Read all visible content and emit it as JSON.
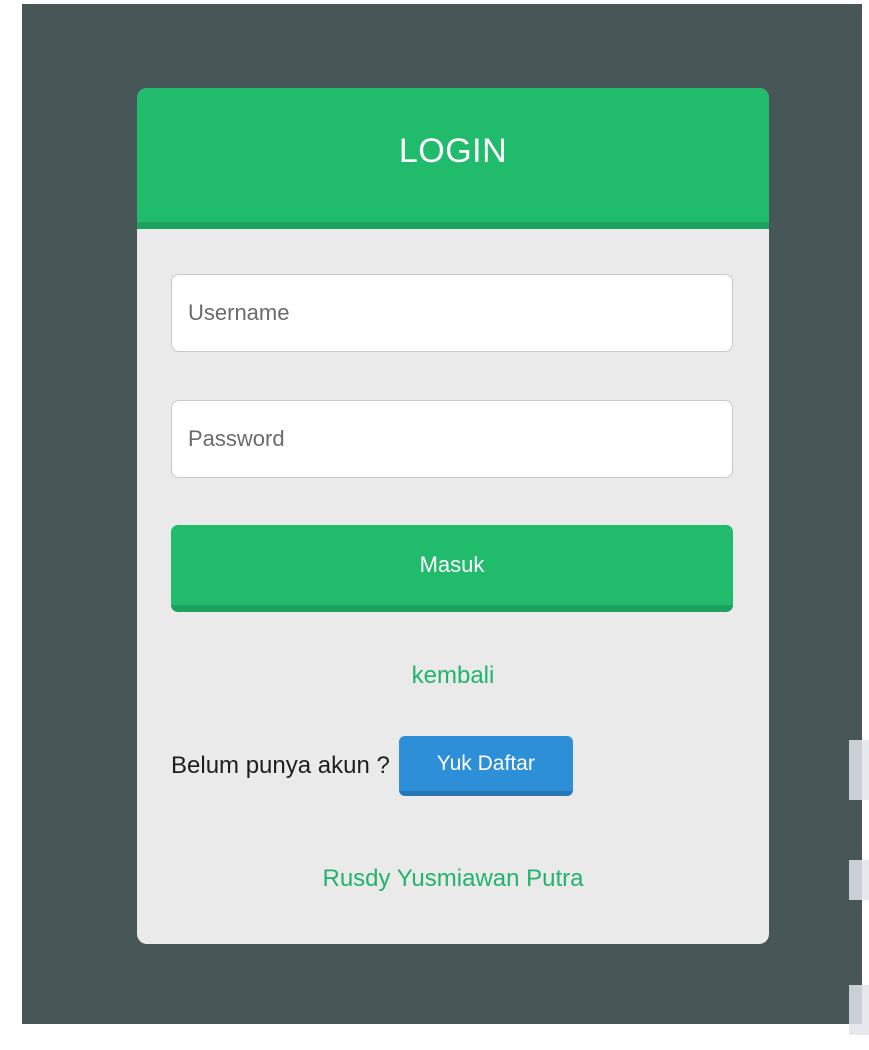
{
  "login": {
    "title": "LOGIN",
    "username_placeholder": "Username",
    "password_placeholder": "Password",
    "submit_label": "Masuk",
    "back_link": "kembali",
    "signup_prompt": "Belum punya akun ?",
    "signup_button": "Yuk Daftar",
    "footer_author": "Rusdy Yusmiawan Putra"
  },
  "colors": {
    "page_background": "#475657",
    "card_background": "#eaeaea",
    "accent_green": "#21bb6c",
    "signup_blue": "#2d8fd8"
  }
}
